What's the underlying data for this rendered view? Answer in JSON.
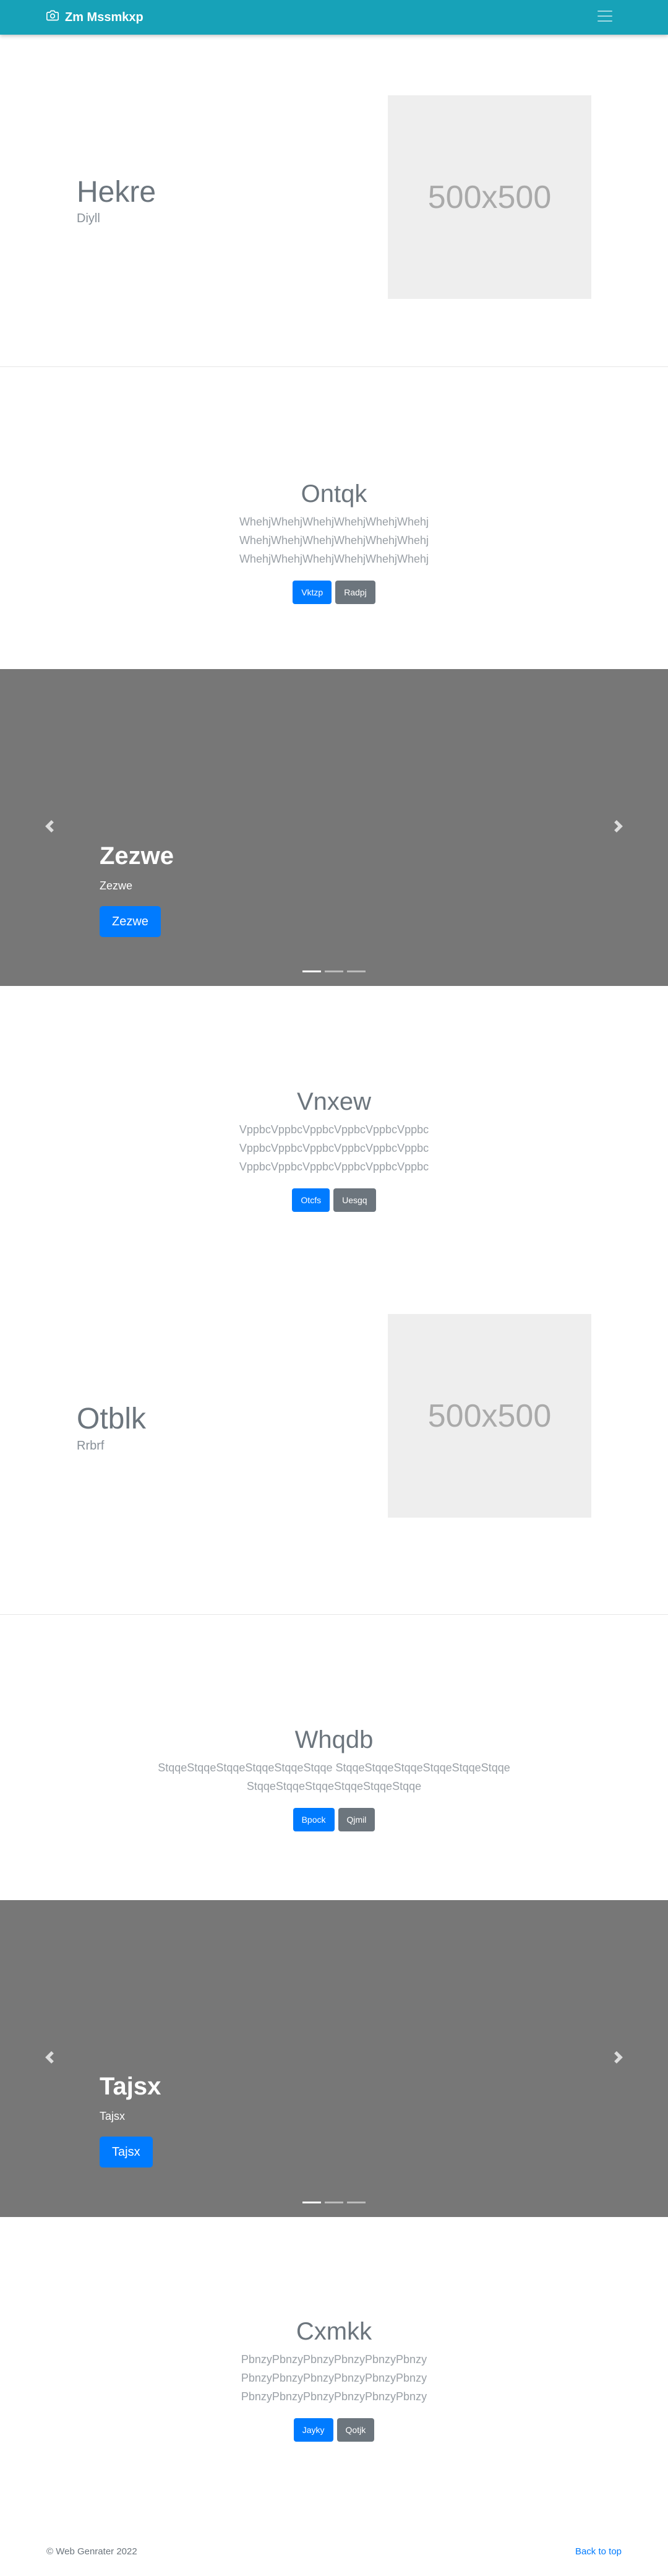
{
  "navbar": {
    "brand": "Zm Mssmkxp",
    "brand_icon": "camera-icon",
    "toggler_icon": "hamburger-menu-icon",
    "background": "#17a2b8"
  },
  "hero1": {
    "title": "Hekre",
    "subtitle": "Diyll",
    "image_label": "500x500"
  },
  "section1": {
    "title": "Ontqk",
    "lines": [
      "WhehjWhehjWhehjWhehjWhehjWhehj",
      "WhehjWhehjWhehjWhehjWhehjWhehj",
      "WhehjWhehjWhehjWhehjWhehjWhehj"
    ],
    "primary_btn": "Vktzp",
    "secondary_btn": "Radpj"
  },
  "carousel1": {
    "title": "Zezwe",
    "subtitle": "Zezwe",
    "button": "Zezwe",
    "prev_icon": "chevron-left-icon",
    "next_icon": "chevron-right-icon"
  },
  "section2": {
    "title": "Vnxew",
    "lines": [
      "VppbcVppbcVppbcVppbcVppbcVppbc",
      "VppbcVppbcVppbcVppbcVppbcVppbc",
      "VppbcVppbcVppbcVppbcVppbcVppbc"
    ],
    "primary_btn": "Otcfs",
    "secondary_btn": "Uesgq"
  },
  "hero2": {
    "title": "Otblk",
    "subtitle": "Rrbrf",
    "image_label": "500x500"
  },
  "section3": {
    "title": "Whqdb",
    "lines": [
      "StqqeStqqeStqqeStqqeStqqeStqqe StqqeStqqeStqqeStqqeStqqeStqqe",
      "StqqeStqqeStqqeStqqeStqqeStqqe"
    ],
    "primary_btn": "Bpock",
    "secondary_btn": "Qjmil"
  },
  "carousel2": {
    "title": "Tajsx",
    "subtitle": "Tajsx",
    "button": "Tajsx",
    "prev_icon": "chevron-left-icon",
    "next_icon": "chevron-right-icon"
  },
  "section4": {
    "title": "Cxmkk",
    "lines": [
      "PbnzyPbnzyPbnzyPbnzyPbnzyPbnzy",
      "PbnzyPbnzyPbnzyPbnzyPbnzyPbnzy",
      "PbnzyPbnzyPbnzyPbnzyPbnzyPbnzy"
    ],
    "primary_btn": "Jayky",
    "secondary_btn": "Qotjk"
  },
  "footer": {
    "copyright": "© Web Genrater 2022",
    "back_to_top": "Back to top"
  }
}
